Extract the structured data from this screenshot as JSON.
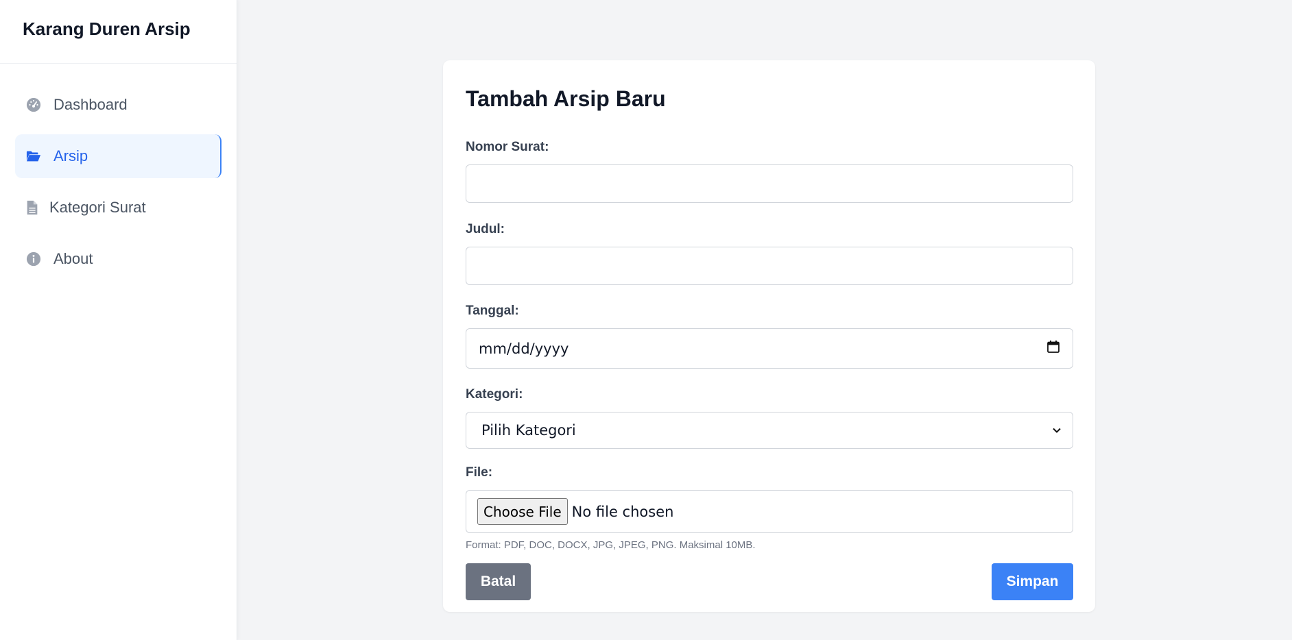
{
  "app": {
    "title": "Karang Duren Arsip"
  },
  "sidebar": {
    "items": [
      {
        "label": "Dashboard",
        "icon": "gauge-icon",
        "active": false
      },
      {
        "label": "Arsip",
        "icon": "folder-open-icon",
        "active": true
      },
      {
        "label": "Kategori Surat",
        "icon": "file-icon",
        "active": false
      },
      {
        "label": "About",
        "icon": "info-icon",
        "active": false
      }
    ]
  },
  "form": {
    "title": "Tambah Arsip Baru",
    "nomor_surat": {
      "label": "Nomor Surat:",
      "value": ""
    },
    "judul": {
      "label": "Judul:",
      "value": ""
    },
    "tanggal": {
      "label": "Tanggal:",
      "placeholder": "mm/dd/yyyy"
    },
    "kategori": {
      "label": "Kategori:",
      "selected": "Pilih Kategori"
    },
    "file": {
      "label": "File:",
      "button_label": "Choose File",
      "status": "No file chosen",
      "hint": "Format: PDF, DOC, DOCX, JPG, JPEG, PNG. Maksimal 10MB."
    },
    "cancel_label": "Batal",
    "save_label": "Simpan"
  },
  "colors": {
    "primary": "#3b82f6",
    "active_text": "#2563eb",
    "active_bg": "#eff6ff",
    "cancel": "#6b7280",
    "page_bg": "#f3f4f6"
  }
}
